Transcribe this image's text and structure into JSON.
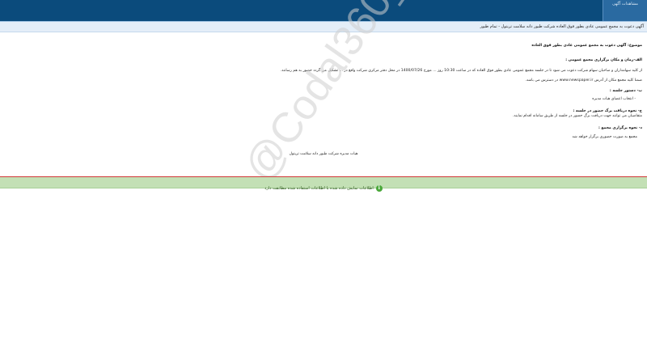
{
  "topbar": {
    "tab_label": "مشاهدات آگهی"
  },
  "title": "آگهی دعوت به مجمع عمومی عادی بطور فوق العاده شرکت طیور دانه سلامت تربتول - تمام طیور",
  "document": {
    "subject": "موضوع: آگهی دعوت به مجمع عمومی عادی بطور فوق العاده",
    "section_time_place": "الف-زمان و مکان برگزاری مجمع عمومی :",
    "body_line1": "از کلیه سهامداران و صاحبان سهام شرکت دعوت می شود تا در جلسه مجمع عمومی عادی بطور فوق العاده که در ساعت 10:30 روز ... مورخ 1400/07/26 در محل دفتر مرکزی شرکت واقع در ... تشکیل می گردد حضور به هم رسانند.",
    "body_line2": "ضمنا کلیه مجمع مکان از آدرس www.newspaper.ir در دسترس می باشد.",
    "section_agenda": "ب- دستور جلسه :",
    "agenda_item": "- انتخاب اعضای هیات مدیره",
    "section_notice": "ج- نحوه دریافت برگ حضور در جلسه :",
    "notice_text": "متقاضیان می توانند جهت دریافت برگ حضور در جلسه از طریق سامانه اقدام نمایند.",
    "section_method": "د- نحوه برگزاری مجمع :",
    "method_text": "مجمع به صورت حضوری برگزار خواهد شد",
    "signature": "هیات مدیره شرکت طیور دانه سلامت تربتول"
  },
  "status": {
    "message": "اطلاعات نمایش داده شده با اطلاعات استفاده شده مطابقت دارد"
  },
  "watermark": "@Codal360_ir",
  "colors": {
    "topbar": "#0b4b7c",
    "status_bg": "#c3e0b5",
    "status_border": "#d13a3a"
  }
}
